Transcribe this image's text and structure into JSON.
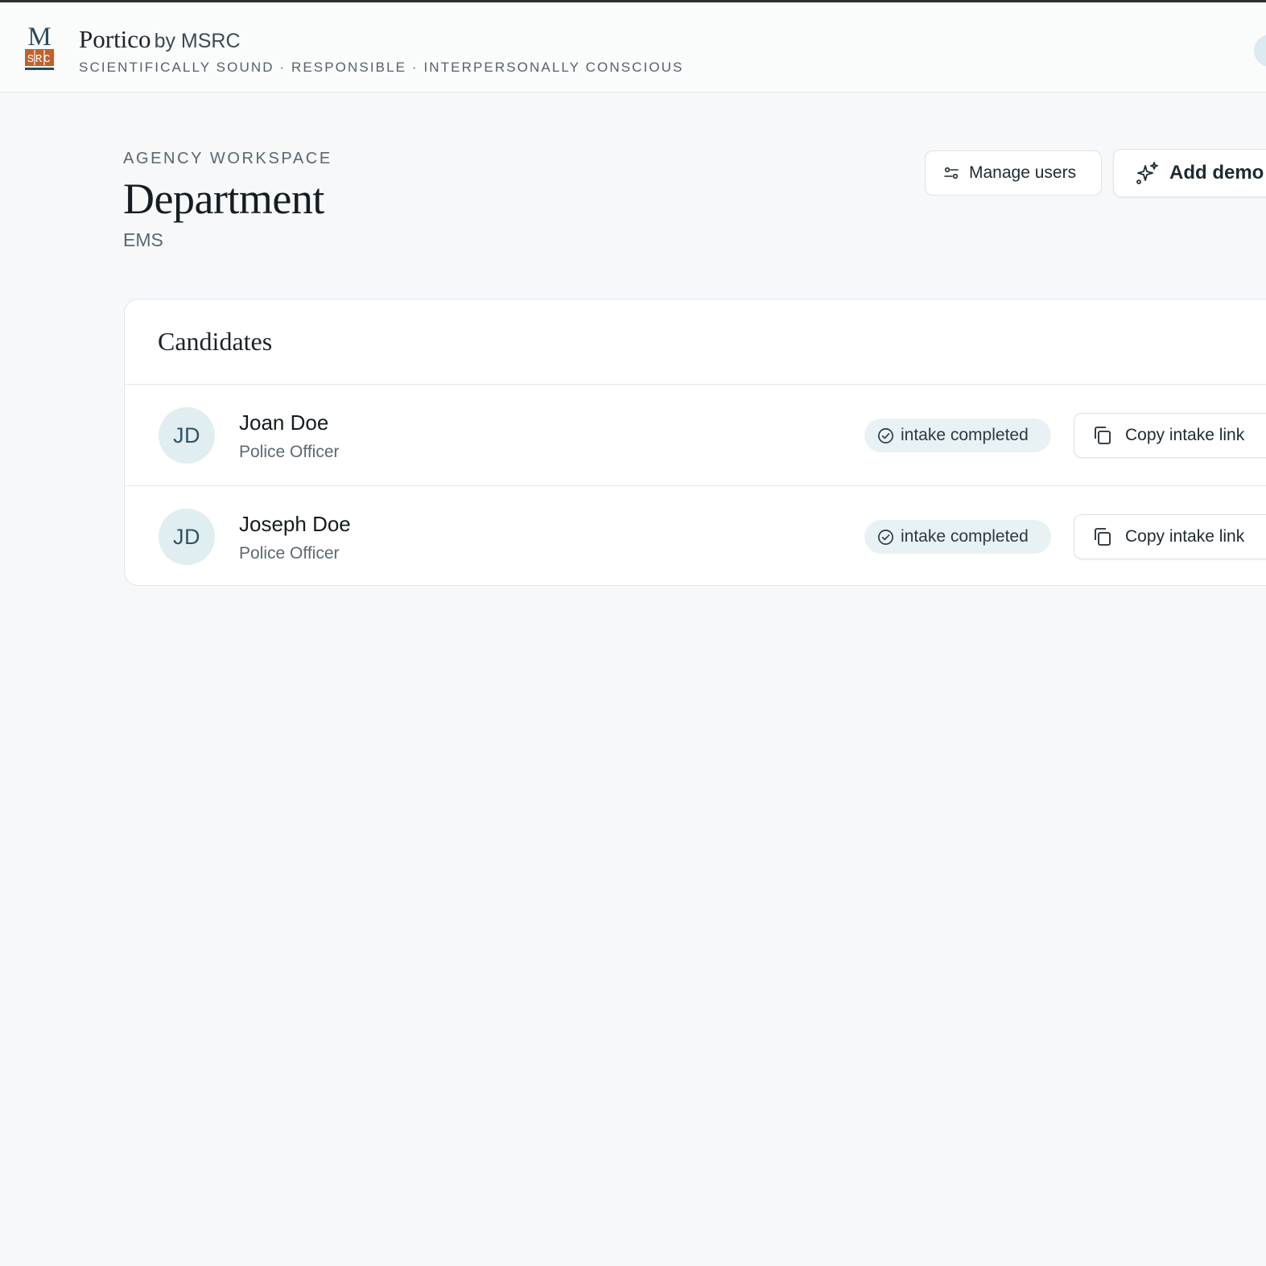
{
  "header": {
    "brand": "Portico",
    "brand_suffix": "by MSRC",
    "tagline": "SCIENTIFICALLY SOUND · RESPONSIBLE · INTERPERSONALLY CONSCIOUS",
    "logo_letter": "M",
    "logo_sub": "SRC"
  },
  "page": {
    "eyebrow": "AGENCY WORKSPACE",
    "title": "Department",
    "subtitle": "EMS"
  },
  "actions": {
    "manage_users": "Manage users",
    "add_demo": "Add demo"
  },
  "candidates": {
    "title": "Candidates",
    "rows": [
      {
        "initials": "JD",
        "name": "Joan Doe",
        "role": "Police Officer",
        "status": "intake completed",
        "action": "Copy intake link"
      },
      {
        "initials": "JD",
        "name": "Joseph Doe",
        "role": "Police Officer",
        "status": "intake completed",
        "action": "Copy intake link"
      }
    ]
  },
  "colors": {
    "accent_navy": "#2b4a5c",
    "logo_orange": "#c2602a",
    "status_pill_bg": "#e8f1f4",
    "avatar_bg": "#e0edf1"
  },
  "icons": {
    "manage_users": "sliders-icon",
    "add_demo": "sparkles-icon",
    "status": "check-circle-icon",
    "copy": "copy-icon"
  }
}
